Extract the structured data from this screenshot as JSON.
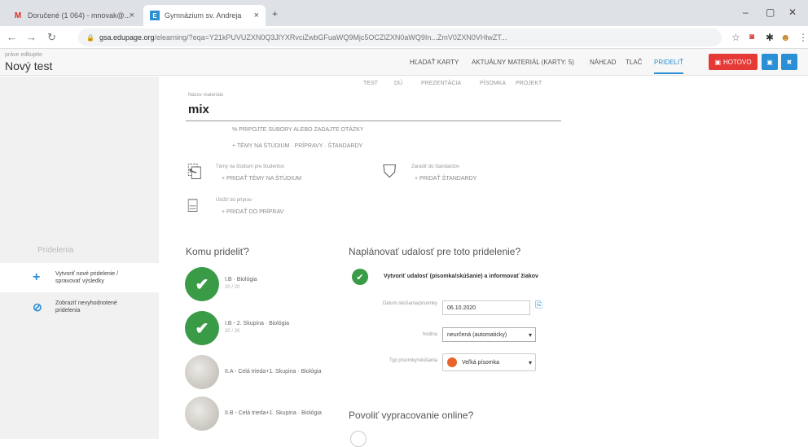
{
  "browser": {
    "tabs": [
      {
        "label": "Doručené (1 064) - mnovak@...",
        "favicon": "M"
      },
      {
        "label": "Gymnázium sv. Andreja",
        "favicon": "E"
      }
    ],
    "new_tab": "+",
    "url_host": "gsa.edupage.org",
    "url_path": "/elearning/?eqa=Y21kPUVUZXN0Q3JlYXRvciZwbGFuaWQ9Mjc5OCZlZXN0aWQ9In...ZmV0ZXN0VHlwZT...",
    "window_controls": [
      "–",
      "▢",
      "✕"
    ]
  },
  "app": {
    "edit_label": "práve editujete",
    "title": "Nový test",
    "nav": [
      "HĽADAŤ KARTY",
      "AKTUÁLNY MATERIÁL (KARTY: 5)",
      "NÁHĽAD",
      "TLAČ",
      "PRIDELIŤ"
    ],
    "done_label": "HOTOVO",
    "accent": "#2a8fd4",
    "danger": "#e53935"
  },
  "subtabs": [
    "TEST",
    "DÚ",
    "PREZENTÁCIA",
    "PÍSOMKA",
    "PROJEKT"
  ],
  "material": {
    "name_label": "Názov materiálu",
    "name_value": "mix",
    "link_files": "PRIPOJTE SÚBORY ALEBO ZADAJTE OTÁZKY",
    "link_topics": "TÉMY NA ŠTÚDIUM · PRÍPRAVY · ŠTANDARDY"
  },
  "blocks": {
    "topics_label": "Témy na štúdium pre študentov",
    "topics_action": "+ PRIDAŤ TÉMY NA ŠTÚDIUM",
    "standards_label": "Zaradiť do štandardov",
    "standards_action": "+ PRIDAŤ ŠTANDARDY",
    "prep_label": "Uložiť do príprav",
    "prep_action": "+ PRIDAŤ DO PRÍPRAV"
  },
  "sidebar": {
    "title": "Pridelenia",
    "items": [
      {
        "label": "Vytvoriť nové pridelenie / spravovať výsledky",
        "icon": "+"
      },
      {
        "label": "Zobraziť nevyhodnotené pridelenia",
        "icon": "⊘"
      }
    ]
  },
  "assign": {
    "heading": "Komu prideliť?",
    "groups": [
      {
        "name": "I.B · Biológia",
        "count": "20 / 20",
        "selected": true
      },
      {
        "name": "I.B - 2. Skupina · Biológia",
        "count": "20 / 20",
        "selected": true
      },
      {
        "name": "II.A - Celá trieda+1. Skupina · Biológia",
        "count": "",
        "selected": false
      },
      {
        "name": "II.B - Celá trieda+1. Skupina · Biológia",
        "count": "",
        "selected": false
      }
    ]
  },
  "plan": {
    "heading": "Naplánovať udalosť pre toto pridelenie?",
    "create_event": "Vytvoriť udalosť (písomka/skúšanie) a informovať žiakov",
    "date_label": "Dátum skúšania/písomky",
    "date_value": "06.10.2020",
    "hour_label": "hodina",
    "hour_value": "neurčená (automaticky)",
    "type_label": "Typ písomky/skúšania",
    "type_value": "Veľká písomka"
  },
  "online": {
    "heading": "Povoliť vypracovanie online?"
  }
}
